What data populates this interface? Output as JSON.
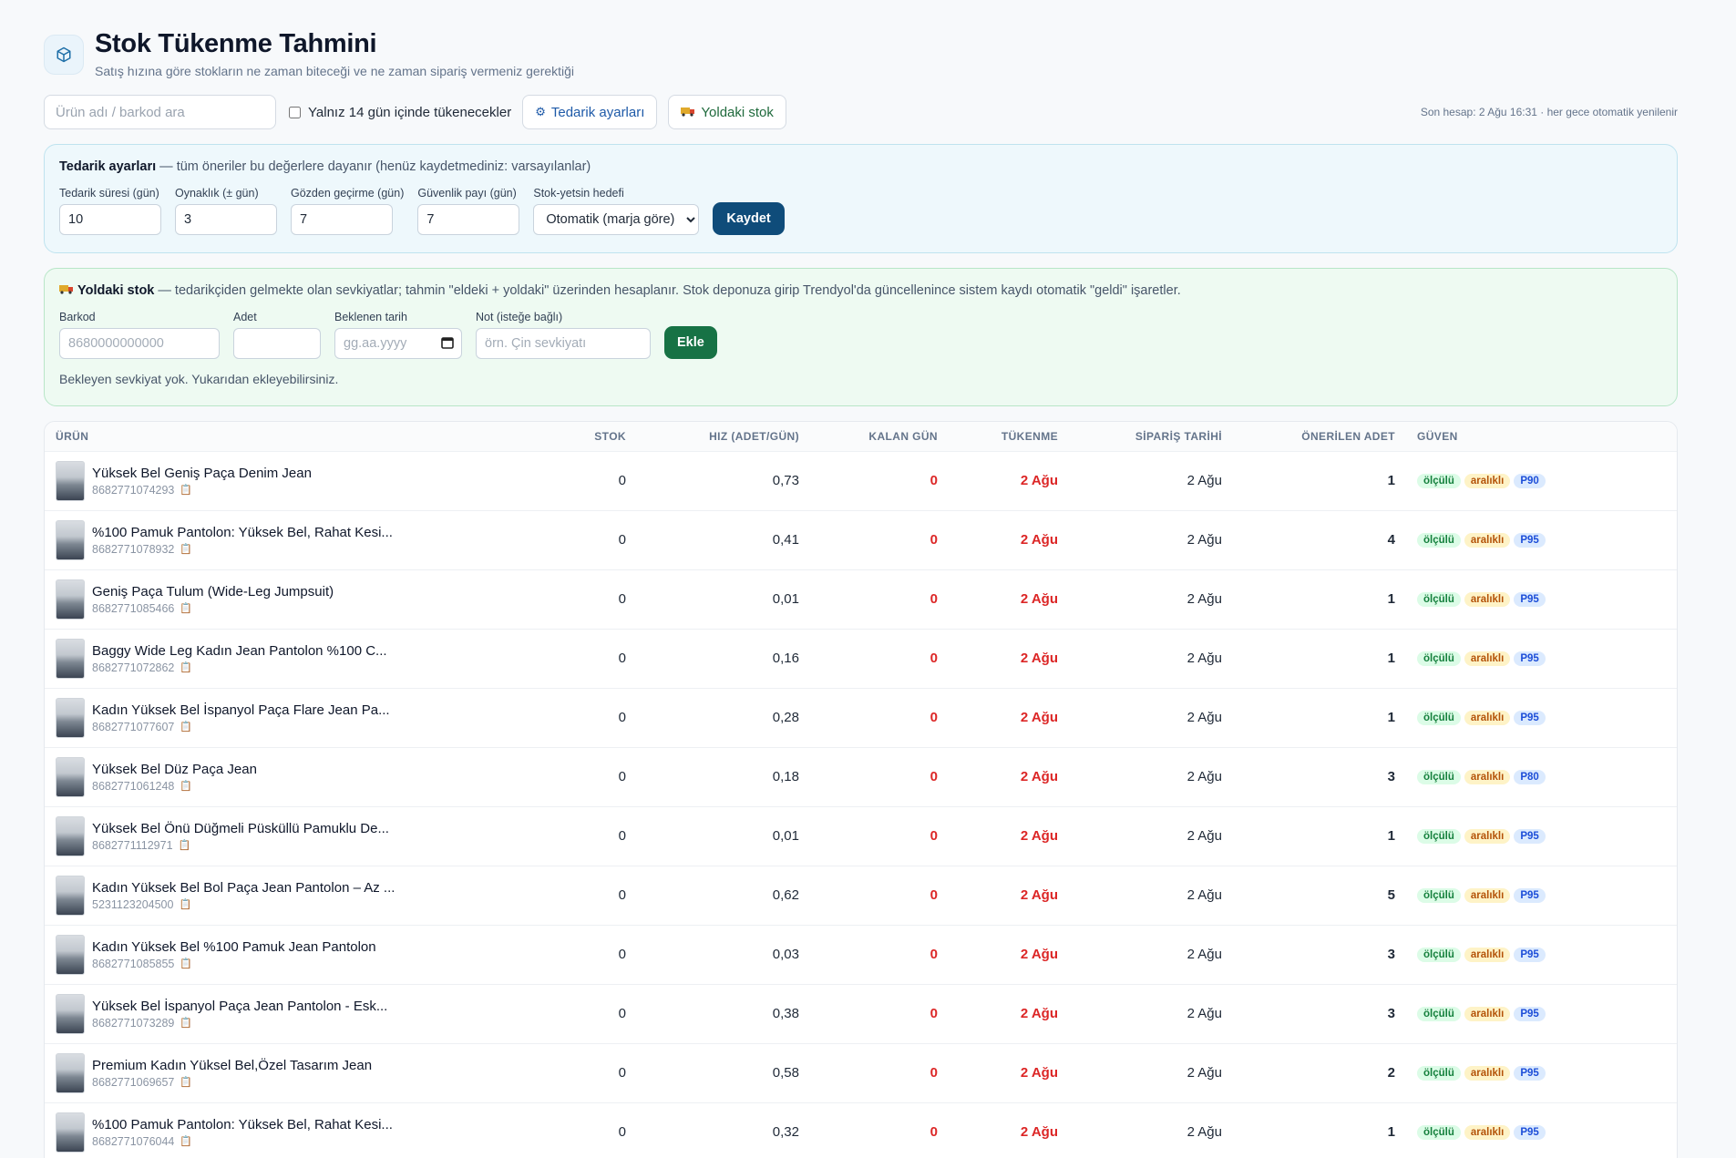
{
  "header": {
    "title": "Stok Tükenme Tahmini",
    "subtitle": "Satış hızına göre stokların ne zaman biteceği ve ne zaman sipariş vermeniz gerektiği"
  },
  "toolbar": {
    "search_placeholder": "Ürün adı / barkod ara",
    "filter_label": "Yalnız 14 gün içinde tükenecekler",
    "supply_settings_label": "Tedarik ayarları",
    "transit_stock_label": "Yoldaki stok",
    "last_calc": "Son hesap: 2 Ağu 16:31 · her gece otomatik yenilenir"
  },
  "supply": {
    "title": "Tedarik ayarları",
    "note": " — tüm öneriler bu değerlere dayanır (henüz kaydetmediniz: varsayılanlar)",
    "fields": {
      "lead_time_label": "Tedarik süresi (gün)",
      "lead_time": "10",
      "variance_label": "Oynaklık (± gün)",
      "variance": "3",
      "review_label": "Gözden geçirme (gün)",
      "review": "7",
      "safety_label": "Güvenlik payı (gün)",
      "safety": "7",
      "target_label": "Stok-yetsin hedefi",
      "target": "Otomatik (marja göre)"
    },
    "save_label": "Kaydet"
  },
  "transit": {
    "title": "Yoldaki stok",
    "note": " — tedarikçiden gelmekte olan sevkiyatlar; tahmin \"eldeki + yoldaki\" üzerinden hesaplanır. Stok deponuza girip Trendyol'da güncellenince sistem kaydı otomatik \"geldi\" işaretler.",
    "barcode_label": "Barkod",
    "barcode_placeholder": "8680000000000",
    "qty_label": "Adet",
    "date_label": "Beklenen tarih",
    "date_placeholder": "gg.aa.yyyy",
    "note_label": "Not (isteğe bağlı)",
    "note_placeholder": "örn. Çin sevkiyatı",
    "add_label": "Ekle",
    "empty": "Bekleyen sevkiyat yok. Yukarıdan ekleyebilirsiniz."
  },
  "table": {
    "columns": [
      "ÜRÜN",
      "STOK",
      "HIZ (ADET/GÜN)",
      "KALAN GÜN",
      "TÜKENME",
      "SİPARİŞ TARİHİ",
      "ÖNERİLEN ADET",
      "GÜVEN"
    ],
    "rows": [
      {
        "name": "Yüksek Bel Geniş Paça Denim Jean",
        "code": "8682771074293",
        "stock": "0",
        "speed": "0,73",
        "days": "0",
        "out": "2 Ağu",
        "order": "2 Ağu",
        "qty": "1",
        "b1": "ölçülü",
        "b2": "aralıklı",
        "b3": "P90"
      },
      {
        "name": "%100 Pamuk Pantolon: Yüksek Bel, Rahat Kesi...",
        "code": "8682771078932",
        "stock": "0",
        "speed": "0,41",
        "days": "0",
        "out": "2 Ağu",
        "order": "2 Ağu",
        "qty": "4",
        "b1": "ölçülü",
        "b2": "aralıklı",
        "b3": "P95"
      },
      {
        "name": "Geniş Paça Tulum (Wide-Leg Jumpsuit)",
        "code": "8682771085466",
        "stock": "0",
        "speed": "0,01",
        "days": "0",
        "out": "2 Ağu",
        "order": "2 Ağu",
        "qty": "1",
        "b1": "ölçülü",
        "b2": "aralıklı",
        "b3": "P95"
      },
      {
        "name": "Baggy Wide Leg Kadın Jean Pantolon %100 C...",
        "code": "8682771072862",
        "stock": "0",
        "speed": "0,16",
        "days": "0",
        "out": "2 Ağu",
        "order": "2 Ağu",
        "qty": "1",
        "b1": "ölçülü",
        "b2": "aralıklı",
        "b3": "P95"
      },
      {
        "name": "Kadın Yüksek Bel İspanyol Paça Flare Jean Pa...",
        "code": "8682771077607",
        "stock": "0",
        "speed": "0,28",
        "days": "0",
        "out": "2 Ağu",
        "order": "2 Ağu",
        "qty": "1",
        "b1": "ölçülü",
        "b2": "aralıklı",
        "b3": "P95"
      },
      {
        "name": "Yüksek Bel Düz Paça Jean",
        "code": "8682771061248",
        "stock": "0",
        "speed": "0,18",
        "days": "0",
        "out": "2 Ağu",
        "order": "2 Ağu",
        "qty": "3",
        "b1": "ölçülü",
        "b2": "aralıklı",
        "b3": "P80"
      },
      {
        "name": "Yüksek Bel Önü Düğmeli Püsküllü Pamuklu De...",
        "code": "8682771112971",
        "stock": "0",
        "speed": "0,01",
        "days": "0",
        "out": "2 Ağu",
        "order": "2 Ağu",
        "qty": "1",
        "b1": "ölçülü",
        "b2": "aralıklı",
        "b3": "P95"
      },
      {
        "name": "Kadın Yüksek Bel Bol Paça Jean Pantolon – Az ...",
        "code": "5231123204500",
        "stock": "0",
        "speed": "0,62",
        "days": "0",
        "out": "2 Ağu",
        "order": "2 Ağu",
        "qty": "5",
        "b1": "ölçülü",
        "b2": "aralıklı",
        "b3": "P95"
      },
      {
        "name": "Kadın Yüksek Bel %100 Pamuk Jean Pantolon",
        "code": "8682771085855",
        "stock": "0",
        "speed": "0,03",
        "days": "0",
        "out": "2 Ağu",
        "order": "2 Ağu",
        "qty": "3",
        "b1": "ölçülü",
        "b2": "aralıklı",
        "b3": "P95"
      },
      {
        "name": "Yüksek Bel İspanyol Paça Jean Pantolon - Esk...",
        "code": "8682771073289",
        "stock": "0",
        "speed": "0,38",
        "days": "0",
        "out": "2 Ağu",
        "order": "2 Ağu",
        "qty": "3",
        "b1": "ölçülü",
        "b2": "aralıklı",
        "b3": "P95"
      },
      {
        "name": "Premium Kadın Yüksel Bel,Özel Tasarım Jean",
        "code": "8682771069657",
        "stock": "0",
        "speed": "0,58",
        "days": "0",
        "out": "2 Ağu",
        "order": "2 Ağu",
        "qty": "2",
        "b1": "ölçülü",
        "b2": "aralıklı",
        "b3": "P95"
      },
      {
        "name": "%100 Pamuk Pantolon: Yüksek Bel, Rahat Kesi...",
        "code": "8682771076044",
        "stock": "0",
        "speed": "0,32",
        "days": "0",
        "out": "2 Ağu",
        "order": "2 Ağu",
        "qty": "1",
        "b1": "ölçülü",
        "b2": "aralıklı",
        "b3": "P95"
      }
    ]
  }
}
